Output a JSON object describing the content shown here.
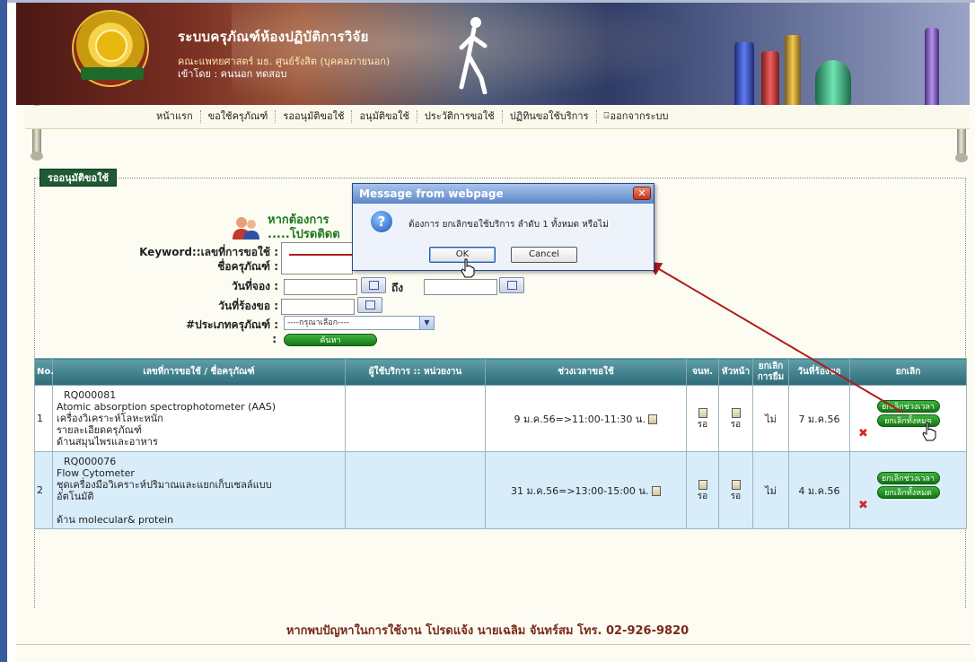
{
  "header": {
    "title": "ระบบครุภัณฑ์ห้องปฏิบัติการวิจัย",
    "subtitle": "คณะแพทยศาสตร์ มธ. ศูนย์รังสิต (บุคคลภายนอก)",
    "user_line": "เข้าโดย : คนนอก ทดสอบ",
    "logo_text": "คณะแพทยศาสตร์"
  },
  "nav": {
    "items": [
      "หน้าแรก",
      "ขอใช้ครุภัณฑ์",
      "รออนุมัติขอใช้",
      "อนุมัติขอใช้",
      "ประวัติการขอใช้",
      "ปฏิทินขอใช้บริการ",
      "ออกจากระบบ"
    ]
  },
  "section": {
    "title": "รออนุมัติขอใช้"
  },
  "contact": {
    "line1": "หากต้องการ",
    "line2": ".....โปรดติดต"
  },
  "form": {
    "keyword_label": "Keyword::เลขที่การขอใช้ :",
    "name_label": "ชื่อครุภัณฑ์ :",
    "booking_date_label": "วันที่จอง :",
    "to_label": "ถึง",
    "request_date_label": "วันที่ร้องขอ :",
    "type_label": "#ประเภทครุภัณฑ์ :",
    "type_select_value": "----กรุณาเลือก----",
    "colon": ":",
    "search_button": "ค้นหา"
  },
  "table": {
    "headers": {
      "no": "No.",
      "item": "เลขที่การขอใช้ / ชื่อครุภัณฑ์",
      "user": "ผู้ใช้บริการ :: หน่วยงาน",
      "time": "ช่วงเวลาขอใช้",
      "officer": "จนท.",
      "head": "หัวหน้า",
      "cancel_borrow": "ยกเลิก การยืม",
      "request_date": "วันที่ร้องขอ",
      "cancel": "ยกเลิก"
    },
    "rows": [
      {
        "no": "1",
        "code": "RQ000081",
        "line1": "Atomic absorption spectrophotometer (AAS)",
        "line2": "เครื่องวิเคราะห์โลหะหนัก",
        "line3": "รายละเอียดครุภัณฑ์",
        "line4": "ด้านสมุนไพรและอาหาร",
        "time": "9 ม.ค.56=>11:00-11:30 น.",
        "officer": "รอ",
        "head": "รอ",
        "cancel_borrow": "ไม่",
        "request_date": "7 ม.ค.56",
        "btn_cancel_time": "ยกเลิกช่วงเวลา",
        "btn_cancel_all": "ยกเลิกทั้งหมด"
      },
      {
        "no": "2",
        "code": "RQ000076",
        "line1": "Flow Cytometer",
        "line2": "ชุดเครื่องมือวิเคราะห์ปริมาณและแยกเก็บเซลล์แบบ",
        "line3": "อัตโนมัติ",
        "line4": "ด้าน molecular& protein",
        "time": "31 ม.ค.56=>13:00-15:00 น.",
        "officer": "รอ",
        "head": "รอ",
        "cancel_borrow": "ไม่",
        "request_date": "4 ม.ค.56",
        "btn_cancel_time": "ยกเลิกช่วงเวลา",
        "btn_cancel_all": "ยกเลิกทั้งหมด"
      }
    ]
  },
  "footer": {
    "text": "หากพบปัญหาในการใช้งาน โปรดแจ้ง นายเฉลิม จันทร์สม โทร. 02-926-9820"
  },
  "dialog": {
    "title": "Message from webpage",
    "message": "ต้องการ ยกเลิกขอใช้บริการ ลำดับ 1 ทั้งหมด หรือไม่",
    "ok": "OK",
    "cancel": "Cancel",
    "close": "✕"
  },
  "colors": {
    "nav_bg": "#fbf9ec",
    "table_header": "#2d6b78",
    "button_green": "#137a13",
    "annotation_arrow": "#b01c1c",
    "dialog_title": "#5d86c6"
  },
  "icons": {
    "logo": "faculty-seal-icon",
    "contact": "people-icon",
    "calendar": "calendar-icon",
    "status": "hourglass-icon",
    "delete": "red-x-icon",
    "question": "question-icon",
    "cursor": "hand-cursor-icon"
  }
}
